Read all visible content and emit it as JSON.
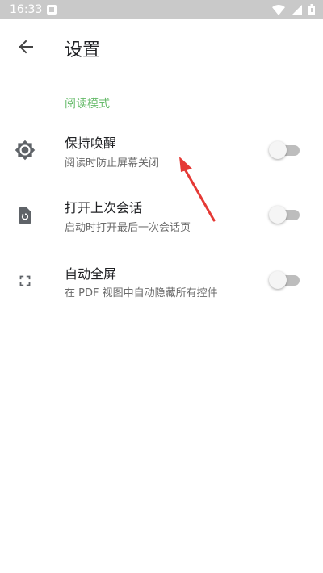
{
  "status_bar": {
    "time": "16:33",
    "icons": [
      "notification-icon",
      "wifi-icon",
      "signal-icon",
      "battery-icon"
    ]
  },
  "app_bar": {
    "title": "设置",
    "back_icon": "arrow-back-icon"
  },
  "section": {
    "header": "阅读模式",
    "header_color": "#66bb6a"
  },
  "settings": [
    {
      "icon": "brightness-icon",
      "title": "保持唤醒",
      "summary": "阅读时防止屏幕关闭",
      "enabled": false
    },
    {
      "icon": "restore-page-icon",
      "title": "打开上次会话",
      "summary": "启动时打开最后一次会话页",
      "enabled": false
    },
    {
      "icon": "fullscreen-icon",
      "title": "自动全屏",
      "summary": "在 PDF 视图中自动隐藏所有控件",
      "enabled": false
    }
  ],
  "annotation": {
    "icon": "red-arrow-icon",
    "color": "#e53935"
  }
}
